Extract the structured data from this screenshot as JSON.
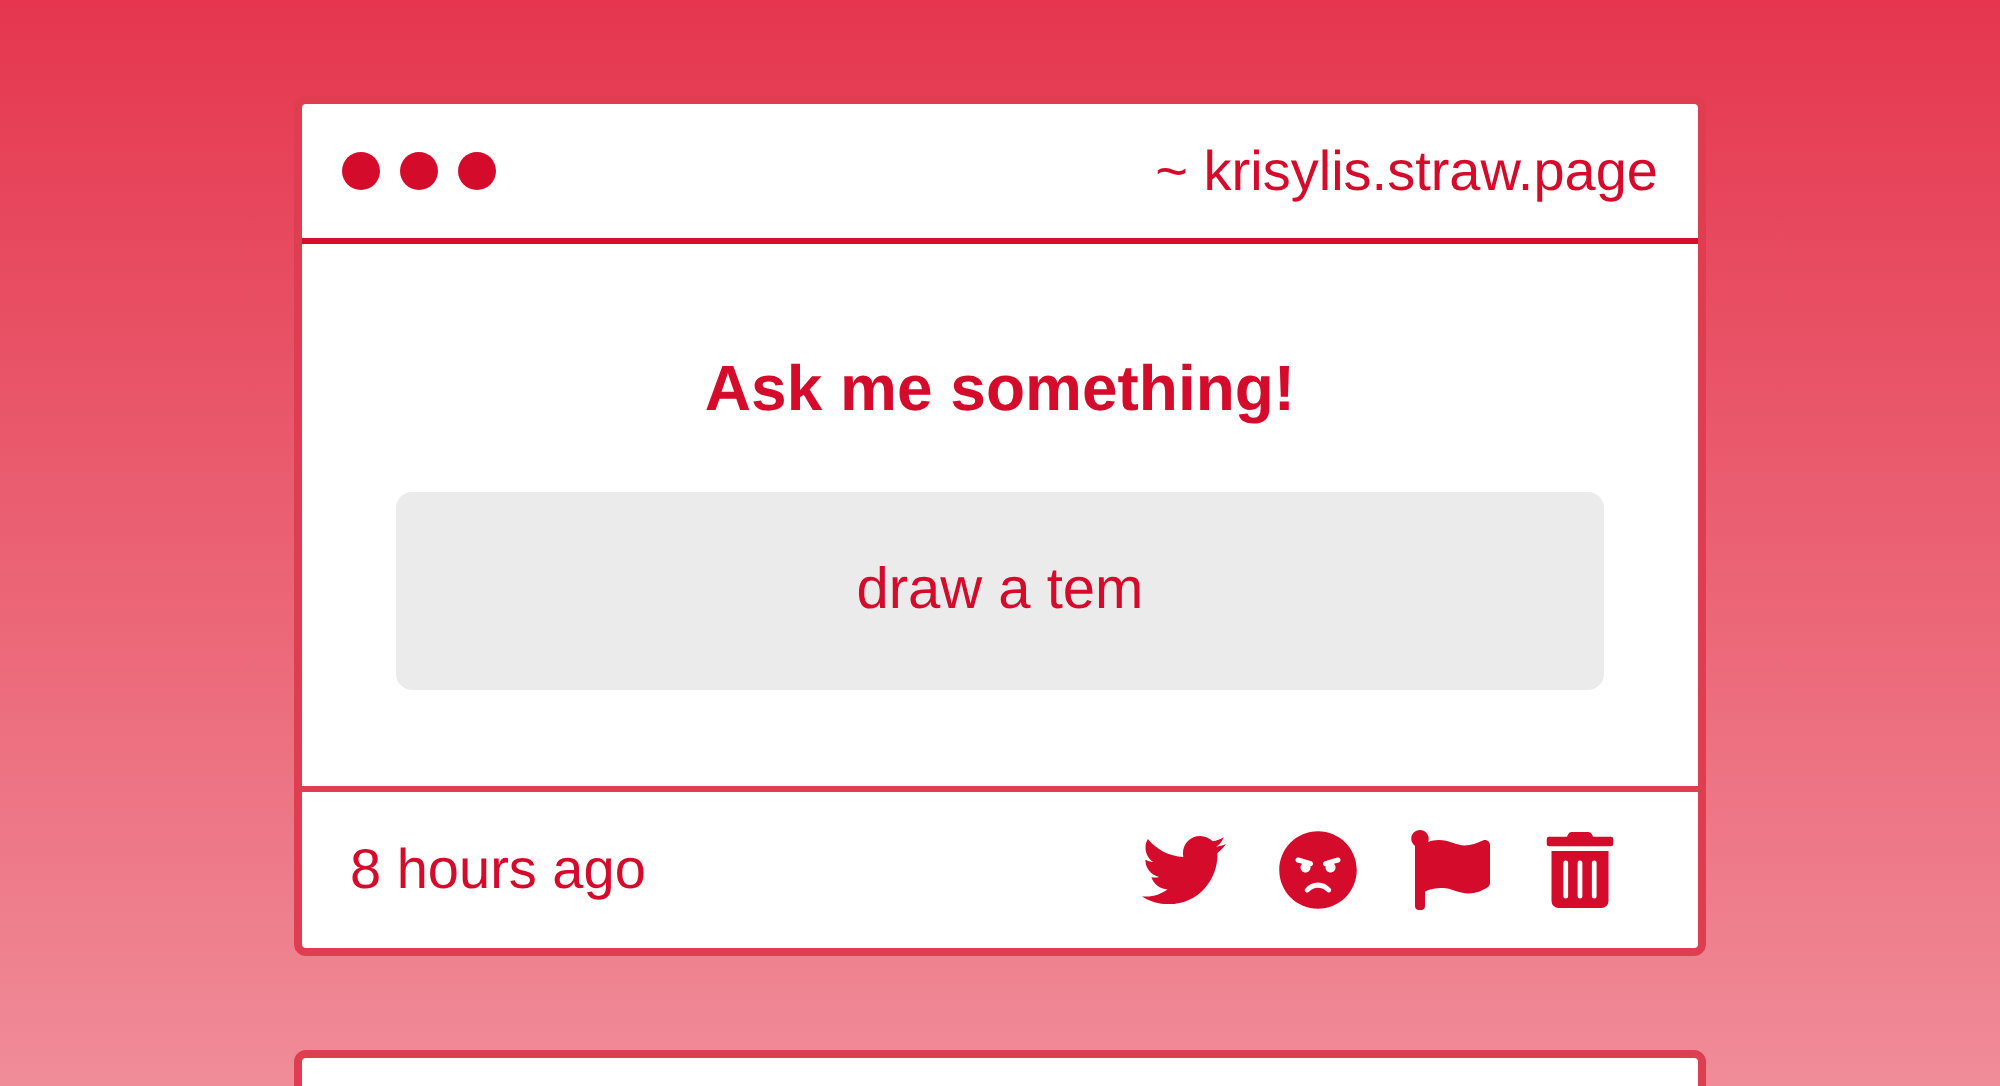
{
  "window": {
    "title": "~ krisylis.straw.page"
  },
  "card": {
    "heading": "Ask me something!",
    "question": "draw a tem",
    "time": "8 hours ago"
  }
}
